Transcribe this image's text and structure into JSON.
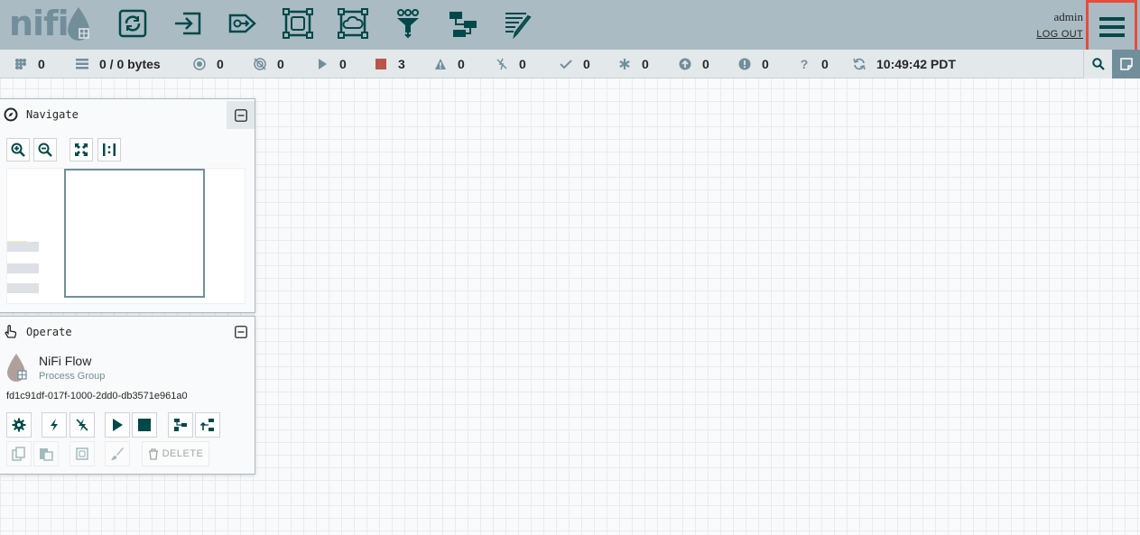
{
  "header": {
    "logo_text": "nifi",
    "components": [
      {
        "name": "processor",
        "icon": "processor-icon"
      },
      {
        "name": "input-port",
        "icon": "input-port-icon"
      },
      {
        "name": "output-port",
        "icon": "output-port-icon"
      },
      {
        "name": "process-group",
        "icon": "process-group-icon"
      },
      {
        "name": "remote-process-group",
        "icon": "remote-process-group-icon"
      },
      {
        "name": "funnel",
        "icon": "funnel-icon"
      },
      {
        "name": "template",
        "icon": "template-icon"
      },
      {
        "name": "label",
        "icon": "label-icon"
      }
    ],
    "user": "admin",
    "logout_label": "LOG OUT",
    "menu_icon": "hamburger-menu-icon",
    "highlight_color": "#e74c3c"
  },
  "status": {
    "active_threads": "0",
    "queued": "0 / 0 bytes",
    "transmitting": "0",
    "not_transmitting": "0",
    "running": "0",
    "stopped": "3",
    "invalid": "0",
    "disabled": "0",
    "up_to_date": "0",
    "locally_modified": "0",
    "stale": "0",
    "locally_modified_stale": "0",
    "sync_failure": "0",
    "last_refresh": "10:49:42 PDT"
  },
  "navigate": {
    "title": "Navigate"
  },
  "operate": {
    "title": "Operate",
    "name": "NiFi Flow",
    "type": "Process Group",
    "id": "fd1c91df-017f-1000-2dd0-db3571e961a0",
    "delete_label": "DELETE"
  },
  "colors": {
    "header_bg": "#aabbc3",
    "icon_dark": "#004849",
    "status_bg": "#e3e8eb",
    "stopped": "#ba554a"
  }
}
